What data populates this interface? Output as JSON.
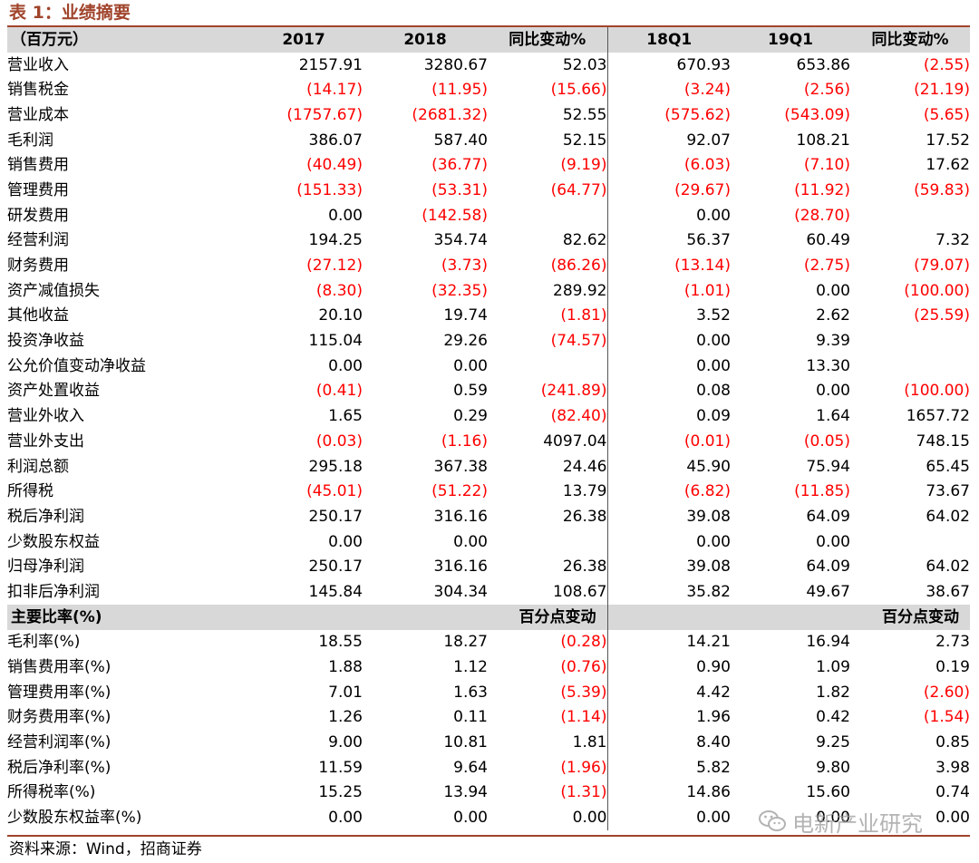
{
  "caption": "表 1：业绩摘要",
  "header": [
    "（百万元）",
    "2017",
    "2018",
    "同比变动%",
    "18Q1",
    "19Q1",
    "同比变动%"
  ],
  "rows": [
    [
      "营业收入",
      "2157.91",
      "3280.67",
      "52.03",
      "670.93",
      "653.86",
      "(2.55)"
    ],
    [
      "销售税金",
      "(14.17)",
      "(11.95)",
      "(15.66)",
      "(3.24)",
      "(2.56)",
      "(21.19)"
    ],
    [
      "营业成本",
      "(1757.67)",
      "(2681.32)",
      "52.55",
      "(575.62)",
      "(543.09)",
      "(5.65)"
    ],
    [
      "毛利润",
      "386.07",
      "587.40",
      "52.15",
      "92.07",
      "108.21",
      "17.52"
    ],
    [
      "销售费用",
      "(40.49)",
      "(36.77)",
      "(9.19)",
      "(6.03)",
      "(7.10)",
      "17.62"
    ],
    [
      "管理费用",
      "(151.33)",
      "(53.31)",
      "(64.77)",
      "(29.67)",
      "(11.92)",
      "(59.83)"
    ],
    [
      "研发费用",
      "0.00",
      "(142.58)",
      "",
      "0.00",
      "(28.70)",
      ""
    ],
    [
      "经营利润",
      "194.25",
      "354.74",
      "82.62",
      "56.37",
      "60.49",
      "7.32"
    ],
    [
      "财务费用",
      "(27.12)",
      "(3.73)",
      "(86.26)",
      "(13.14)",
      "(2.75)",
      "(79.07)"
    ],
    [
      "资产减值损失",
      "(8.30)",
      "(32.35)",
      "289.92",
      "(1.01)",
      "0.00",
      "(100.00)"
    ],
    [
      "其他收益",
      "20.10",
      "19.74",
      "(1.81)",
      "3.52",
      "2.62",
      "(25.59)"
    ],
    [
      "投资净收益",
      "115.04",
      "29.26",
      "(74.57)",
      "0.00",
      "9.39",
      ""
    ],
    [
      "公允价值变动净收益",
      "0.00",
      "0.00",
      "",
      "0.00",
      "13.30",
      ""
    ],
    [
      "资产处置收益",
      "(0.41)",
      "0.59",
      "(241.89)",
      "0.08",
      "0.00",
      "(100.00)"
    ],
    [
      "营业外收入",
      "1.65",
      "0.29",
      "(82.40)",
      "0.09",
      "1.64",
      "1657.72"
    ],
    [
      "营业外支出",
      "(0.03)",
      "(1.16)",
      "4097.04",
      "(0.01)",
      "(0.05)",
      "748.15"
    ],
    [
      "利润总额",
      "295.18",
      "367.38",
      "24.46",
      "45.90",
      "75.94",
      "65.45"
    ],
    [
      "所得税",
      "(45.01)",
      "(51.22)",
      "13.79",
      "(6.82)",
      "(11.85)",
      "73.67"
    ],
    [
      "税后净利润",
      "250.17",
      "316.16",
      "26.38",
      "39.08",
      "64.09",
      "64.02"
    ],
    [
      "少数股东权益",
      "0.00",
      "0.00",
      "",
      "0.00",
      "0.00",
      ""
    ],
    [
      "归母净利润",
      "250.17",
      "316.16",
      "26.38",
      "39.08",
      "64.09",
      "64.02"
    ],
    [
      "扣非后净利润",
      "145.84",
      "304.34",
      "108.67",
      "35.82",
      "49.67",
      "38.67"
    ]
  ],
  "ratio_header": [
    "主要比率(%)",
    "",
    "",
    "百分点变动",
    "",
    "",
    "百分点变动"
  ],
  "ratio_rows": [
    [
      "毛利率(%)",
      "18.55",
      "18.27",
      "(0.28)",
      "14.21",
      "16.94",
      "2.73"
    ],
    [
      "销售费用率(%)",
      "1.88",
      "1.12",
      "(0.76)",
      "0.90",
      "1.09",
      "0.19"
    ],
    [
      "管理费用率(%)",
      "7.01",
      "1.63",
      "(5.39)",
      "4.42",
      "1.82",
      "(2.60)"
    ],
    [
      "财务费用率(%)",
      "1.26",
      "0.11",
      "(1.14)",
      "1.96",
      "0.42",
      "(1.54)"
    ],
    [
      "经营利润率(%)",
      "9.00",
      "10.81",
      "1.81",
      "8.40",
      "9.25",
      "0.85"
    ],
    [
      "税后净利率(%)",
      "11.59",
      "9.64",
      "(1.96)",
      "5.82",
      "9.80",
      "3.98"
    ],
    [
      "所得税率(%)",
      "15.25",
      "13.94",
      "(1.31)",
      "14.86",
      "15.60",
      "0.74"
    ],
    [
      "少数股东权益率(%)",
      "0.00",
      "0.00",
      "0.00",
      "0.00",
      "0.00",
      "0.00"
    ]
  ],
  "source": "资料来源：Wind，招商证券",
  "watermark": "电新产业研究",
  "colors": {
    "negative": "#ff0000",
    "caption": "#a0442b",
    "header_bg": "#d8d8d8"
  }
}
